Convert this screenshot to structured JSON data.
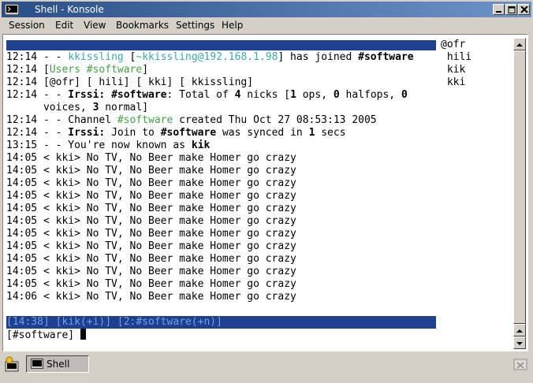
{
  "window": {
    "title": "Shell - Konsole"
  },
  "menubar": [
    "Session",
    "Edit",
    "View",
    "Bookmarks",
    "Settings",
    "Help"
  ],
  "terminal": {
    "lines": [
      [
        {
          "t": "12:14 - - "
        },
        {
          "t": "kkissling",
          "c": "cyan"
        },
        {
          "t": " ["
        },
        {
          "t": "~kkissling@192.168.1.98",
          "c": "cyan"
        },
        {
          "t": "] has joined "
        },
        {
          "t": "#software",
          "b": true
        }
      ],
      [
        {
          "t": "12:14 ["
        },
        {
          "t": "Users #software",
          "c": "green"
        },
        {
          "t": "]"
        }
      ],
      [
        {
          "t": "12:14 [@ofr] [ hili] [ kki] [ kkissling]"
        }
      ],
      [
        {
          "t": "12:14 - - "
        },
        {
          "t": "Irssi: #software",
          "b": true
        },
        {
          "t": ": Total of "
        },
        {
          "t": "4",
          "b": true
        },
        {
          "t": " nicks ["
        },
        {
          "t": "1",
          "b": true
        },
        {
          "t": " ops, "
        },
        {
          "t": "0",
          "b": true
        },
        {
          "t": " halfops, "
        },
        {
          "t": "0",
          "b": true
        }
      ],
      [
        {
          "t": "      voices, "
        },
        {
          "t": "3",
          "b": true
        },
        {
          "t": " normal]"
        }
      ],
      [
        {
          "t": "12:14 - - Channel "
        },
        {
          "t": "#software",
          "c": "green"
        },
        {
          "t": " created Thu Oct 27 08:53:13 2005"
        }
      ],
      [
        {
          "t": "12:14 - - "
        },
        {
          "t": "Irssi:",
          "b": true
        },
        {
          "t": " Join to "
        },
        {
          "t": "#software",
          "b": true
        },
        {
          "t": " was synced in "
        },
        {
          "t": "1",
          "b": true
        },
        {
          "t": " secs"
        }
      ],
      [
        {
          "t": "13:15 - - You're now known as "
        },
        {
          "t": "kik",
          "b": true
        }
      ],
      [
        {
          "t": "14:05 < kki> No TV, No Beer make Homer go crazy"
        }
      ],
      [
        {
          "t": "14:05 < kki> No TV, No Beer make Homer go crazy"
        }
      ],
      [
        {
          "t": "14:05 < kki> No TV, No Beer make Homer go crazy"
        }
      ],
      [
        {
          "t": "14:05 < kki> No TV, No Beer make Homer go crazy"
        }
      ],
      [
        {
          "t": "14:05 < kki> No TV, No Beer make Homer go crazy"
        }
      ],
      [
        {
          "t": "14:05 < kki> No TV, No Beer make Homer go crazy"
        }
      ],
      [
        {
          "t": "14:05 < kki> No TV, No Beer make Homer go crazy"
        }
      ],
      [
        {
          "t": "14:05 < kki> No TV, No Beer make Homer go crazy"
        }
      ],
      [
        {
          "t": "14:05 < kki> No TV, No Beer make Homer go crazy"
        }
      ],
      [
        {
          "t": "14:05 < kki> No TV, No Beer make Homer go crazy"
        }
      ],
      [
        {
          "t": "14:05 < kki> No TV, No Beer make Homer go crazy"
        }
      ],
      [
        {
          "t": "14:06 < kki> No TV, No Beer make Homer go crazy"
        }
      ]
    ],
    "nicklist": [
      "@ofr",
      " hili",
      " kik",
      " kki"
    ],
    "statusbar": "[14:38] [kik(+i)] [2:#software(+n)]",
    "prompt": "[#software] "
  },
  "taskbar": {
    "session_tab": "Shell"
  },
  "colors": {
    "title_bg": "#2a4f86",
    "status_bg": "#1f3f8f",
    "cyan": "#3ea8a8",
    "green": "#45a045"
  }
}
